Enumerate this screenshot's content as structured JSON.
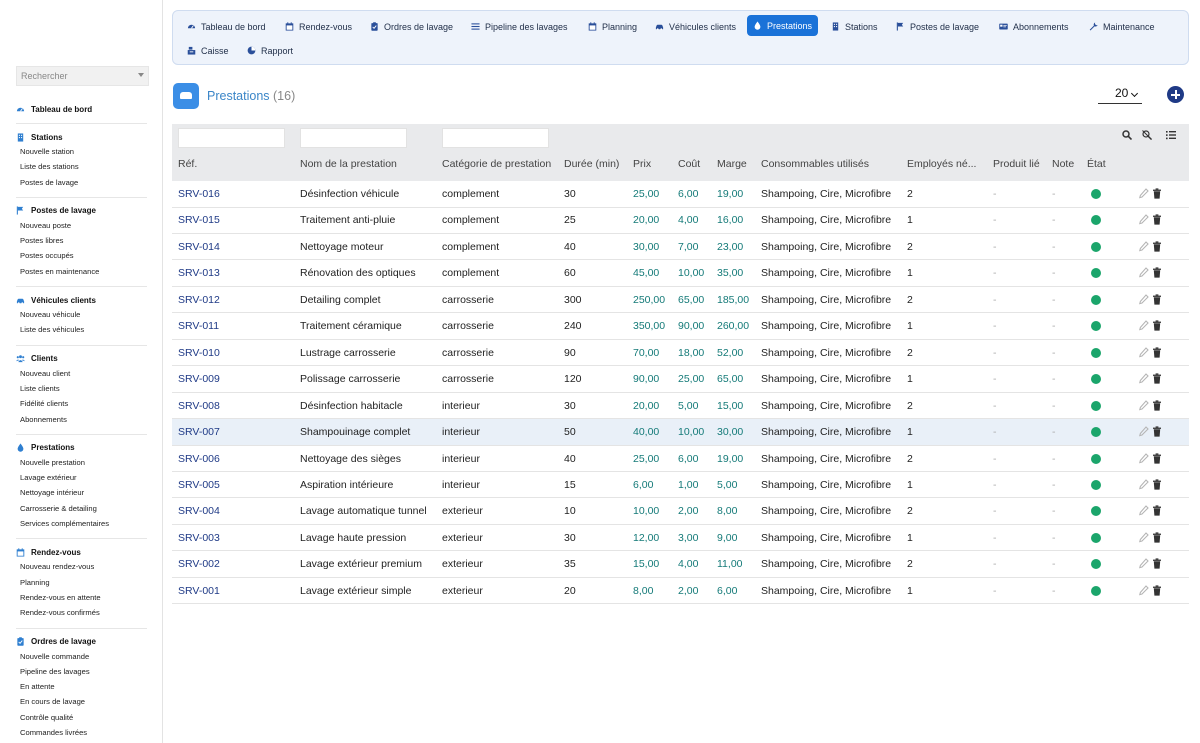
{
  "colors": {
    "accent": "#1a72d8",
    "brand_dark": "#1f3a86",
    "money": "#147a78",
    "status_active": "#1ba56b"
  },
  "sidebar": {
    "search_placeholder": "Rechercher",
    "sections": [
      {
        "title": "Tableau de bord",
        "icon": "dashboard-icon",
        "items": []
      },
      {
        "title": "Stations",
        "icon": "building-icon",
        "items": [
          "Nouvelle station",
          "Liste des stations",
          "Postes de lavage"
        ]
      },
      {
        "title": "Postes de lavage",
        "icon": "flag-icon",
        "items": [
          "Nouveau poste",
          "Postes libres",
          "Postes occupés",
          "Postes en maintenance"
        ]
      },
      {
        "title": "Véhicules clients",
        "icon": "car-icon",
        "items": [
          "Nouveau véhicule",
          "Liste des véhicules"
        ]
      },
      {
        "title": "Clients",
        "icon": "users-icon",
        "items": [
          "Nouveau client",
          "Liste clients",
          "Fidélité clients",
          "Abonnements"
        ]
      },
      {
        "title": "Prestations",
        "icon": "droplet-icon",
        "items": [
          "Nouvelle prestation",
          "Lavage extérieur",
          "Nettoyage intérieur",
          "Carrosserie & detailing",
          "Services complémentaires"
        ]
      },
      {
        "title": "Rendez-vous",
        "icon": "calendar-icon",
        "items": [
          "Nouveau rendez-vous",
          "Planning",
          "Rendez-vous en attente",
          "Rendez-vous confirmés"
        ]
      },
      {
        "title": "Ordres de lavage",
        "icon": "clipboard-icon",
        "items": [
          "Nouvelle commande",
          "Pipeline des lavages",
          "En attente",
          "En cours de lavage",
          "Contrôle qualité",
          "Commandes livrées"
        ]
      }
    ]
  },
  "topnav": {
    "tabs": [
      {
        "label": "Tableau de bord",
        "icon": "dashboard-icon",
        "active": false
      },
      {
        "label": "Rendez-vous",
        "icon": "calendar-icon",
        "active": false
      },
      {
        "label": "Ordres de lavage",
        "icon": "clipboard-icon",
        "active": false
      },
      {
        "label": "Pipeline des lavages",
        "icon": "list-icon",
        "active": false
      },
      {
        "label": "Planning",
        "icon": "calendar-icon",
        "active": false
      },
      {
        "label": "Véhicules clients",
        "icon": "car-icon",
        "active": false
      },
      {
        "label": "Prestations",
        "icon": "droplet-icon",
        "active": true
      },
      {
        "label": "Stations",
        "icon": "building-icon",
        "active": false
      },
      {
        "label": "Postes de lavage",
        "icon": "flag-icon",
        "active": false
      },
      {
        "label": "Abonnements",
        "icon": "card-icon",
        "active": false
      },
      {
        "label": "Maintenance",
        "icon": "wrench-icon",
        "active": false
      },
      {
        "label": "Caisse",
        "icon": "cashier-icon",
        "active": false
      },
      {
        "label": "Rapport",
        "icon": "chart-icon",
        "active": false
      }
    ]
  },
  "page": {
    "title": "Prestations",
    "count": "(16)",
    "per_page": "20"
  },
  "table": {
    "columns": [
      "Réf.",
      "Nom de la prestation",
      "Catégorie de prestation",
      "Durée (min)",
      "Prix",
      "Coût",
      "Marge",
      "Consommables utilisés",
      "Employés né...",
      "Produit lié",
      "Note",
      "État"
    ],
    "rows": [
      {
        "ref": "SRV-016",
        "name": "Désinfection véhicule",
        "category": "complement",
        "duration": "30",
        "price": "25,00",
        "cost": "6,00",
        "margin": "19,00",
        "consumables": "Shampoing, Cire, Microfibre",
        "employees": "2",
        "product": "-",
        "note": "-"
      },
      {
        "ref": "SRV-015",
        "name": "Traitement anti-pluie",
        "category": "complement",
        "duration": "25",
        "price": "20,00",
        "cost": "4,00",
        "margin": "16,00",
        "consumables": "Shampoing, Cire, Microfibre",
        "employees": "1",
        "product": "-",
        "note": "-"
      },
      {
        "ref": "SRV-014",
        "name": "Nettoyage moteur",
        "category": "complement",
        "duration": "40",
        "price": "30,00",
        "cost": "7,00",
        "margin": "23,00",
        "consumables": "Shampoing, Cire, Microfibre",
        "employees": "2",
        "product": "-",
        "note": "-"
      },
      {
        "ref": "SRV-013",
        "name": "Rénovation des optiques",
        "category": "complement",
        "duration": "60",
        "price": "45,00",
        "cost": "10,00",
        "margin": "35,00",
        "consumables": "Shampoing, Cire, Microfibre",
        "employees": "1",
        "product": "-",
        "note": "-"
      },
      {
        "ref": "SRV-012",
        "name": "Detailing complet",
        "category": "carrosserie",
        "duration": "300",
        "price": "250,00",
        "cost": "65,00",
        "margin": "185,00",
        "consumables": "Shampoing, Cire, Microfibre",
        "employees": "2",
        "product": "-",
        "note": "-"
      },
      {
        "ref": "SRV-011",
        "name": "Traitement céramique",
        "category": "carrosserie",
        "duration": "240",
        "price": "350,00",
        "cost": "90,00",
        "margin": "260,00",
        "consumables": "Shampoing, Cire, Microfibre",
        "employees": "1",
        "product": "-",
        "note": "-"
      },
      {
        "ref": "SRV-010",
        "name": "Lustrage carrosserie",
        "category": "carrosserie",
        "duration": "90",
        "price": "70,00",
        "cost": "18,00",
        "margin": "52,00",
        "consumables": "Shampoing, Cire, Microfibre",
        "employees": "2",
        "product": "-",
        "note": "-"
      },
      {
        "ref": "SRV-009",
        "name": "Polissage carrosserie",
        "category": "carrosserie",
        "duration": "120",
        "price": "90,00",
        "cost": "25,00",
        "margin": "65,00",
        "consumables": "Shampoing, Cire, Microfibre",
        "employees": "1",
        "product": "-",
        "note": "-"
      },
      {
        "ref": "SRV-008",
        "name": "Désinfection habitacle",
        "category": "interieur",
        "duration": "30",
        "price": "20,00",
        "cost": "5,00",
        "margin": "15,00",
        "consumables": "Shampoing, Cire, Microfibre",
        "employees": "2",
        "product": "-",
        "note": "-"
      },
      {
        "ref": "SRV-007",
        "name": "Shampouinage complet",
        "category": "interieur",
        "duration": "50",
        "price": "40,00",
        "cost": "10,00",
        "margin": "30,00",
        "consumables": "Shampoing, Cire, Microfibre",
        "employees": "1",
        "product": "-",
        "note": "-"
      },
      {
        "ref": "SRV-006",
        "name": "Nettoyage des sièges",
        "category": "interieur",
        "duration": "40",
        "price": "25,00",
        "cost": "6,00",
        "margin": "19,00",
        "consumables": "Shampoing, Cire, Microfibre",
        "employees": "2",
        "product": "-",
        "note": "-"
      },
      {
        "ref": "SRV-005",
        "name": "Aspiration intérieure",
        "category": "interieur",
        "duration": "15",
        "price": "6,00",
        "cost": "1,00",
        "margin": "5,00",
        "consumables": "Shampoing, Cire, Microfibre",
        "employees": "1",
        "product": "-",
        "note": "-"
      },
      {
        "ref": "SRV-004",
        "name": "Lavage automatique tunnel",
        "category": "exterieur",
        "duration": "10",
        "price": "10,00",
        "cost": "2,00",
        "margin": "8,00",
        "consumables": "Shampoing, Cire, Microfibre",
        "employees": "2",
        "product": "-",
        "note": "-"
      },
      {
        "ref": "SRV-003",
        "name": "Lavage haute pression",
        "category": "exterieur",
        "duration": "30",
        "price": "12,00",
        "cost": "3,00",
        "margin": "9,00",
        "consumables": "Shampoing, Cire, Microfibre",
        "employees": "1",
        "product": "-",
        "note": "-"
      },
      {
        "ref": "SRV-002",
        "name": "Lavage extérieur premium",
        "category": "exterieur",
        "duration": "35",
        "price": "15,00",
        "cost": "4,00",
        "margin": "11,00",
        "consumables": "Shampoing, Cire, Microfibre",
        "employees": "2",
        "product": "-",
        "note": "-"
      },
      {
        "ref": "SRV-001",
        "name": "Lavage extérieur simple",
        "category": "exterieur",
        "duration": "20",
        "price": "8,00",
        "cost": "2,00",
        "margin": "6,00",
        "consumables": "Shampoing, Cire, Microfibre",
        "employees": "1",
        "product": "-",
        "note": "-"
      }
    ]
  }
}
